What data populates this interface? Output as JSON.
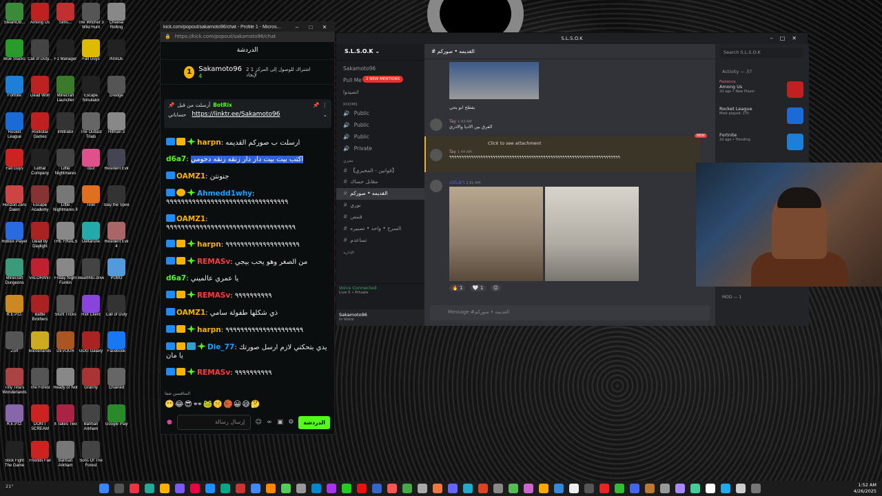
{
  "desktop": {
    "icons": [
      {
        "label": "SteamDB...",
        "color": "#3a8a3a"
      },
      {
        "label": "Among Us",
        "color": "#c02020"
      },
      {
        "label": "Sims...",
        "color": "#c03030"
      },
      {
        "label": "The Witcher 3 Wild Hunt",
        "color": "#555"
      },
      {
        "label": "Cheese Rolling",
        "color": "#888"
      },
      {
        "label": "Blue Stacks",
        "color": "#2a9a2a"
      },
      {
        "label": "Call of Duty...",
        "color": "#444"
      },
      {
        "label": "F1 Manager",
        "color": "#222"
      },
      {
        "label": "Fall Guys",
        "color": "#ddbb00"
      },
      {
        "label": "INSIDE",
        "color": "#222"
      },
      {
        "label": "Fortnite",
        "color": "#1d7fd8"
      },
      {
        "label": "Dead Wolf",
        "color": "#bb2222"
      },
      {
        "label": "Minecraft Launcher",
        "color": "#3a7a2a"
      },
      {
        "label": "Escape Simulator",
        "color": "#222"
      },
      {
        "label": "Dredge",
        "color": "#555"
      },
      {
        "label": "Rocket League",
        "color": "#1a6bd8"
      },
      {
        "label": "Rockstar Games",
        "color": "#c02020"
      },
      {
        "label": "Infiltrator",
        "color": "#333"
      },
      {
        "label": "The Outlast Trials",
        "color": "#666"
      },
      {
        "label": "Hitman 3",
        "color": "#888"
      },
      {
        "label": "Fall Guys",
        "color": "#cc2222"
      },
      {
        "label": "Lethal Company",
        "color": "#222"
      },
      {
        "label": "Little Nightmares",
        "color": "#444"
      },
      {
        "label": "osu!",
        "color": "#e0508a"
      },
      {
        "label": "Resident Evil",
        "color": "#445"
      },
      {
        "label": "Horizon Zero Dawn",
        "color": "#cc4444"
      },
      {
        "label": "Escape Academy",
        "color": "#883333"
      },
      {
        "label": "Little Nightmares II",
        "color": "#777"
      },
      {
        "label": "Tinkr",
        "color": "#e07020"
      },
      {
        "label": "Slay the Spire",
        "color": "#333"
      },
      {
        "label": "Roblox Player",
        "color": "#2a6ae0"
      },
      {
        "label": "Dead by Daylight",
        "color": "#aa2222"
      },
      {
        "label": "THE FINALS",
        "color": "#888"
      },
      {
        "label": "Deltarune",
        "color": "#2aa"
      },
      {
        "label": "Resident Evil 4",
        "color": "#a66"
      },
      {
        "label": "Minecraft Dungeons",
        "color": "#3a9a7a"
      },
      {
        "label": "VALORANT",
        "color": "#c02030"
      },
      {
        "label": "Friday Night Funkin",
        "color": "#888"
      },
      {
        "label": "BeamNG.drive",
        "color": "#444"
      },
      {
        "label": "PUBG",
        "color": "#5599dd"
      },
      {
        "label": "R.E.P.O.",
        "color": "#cc8822"
      },
      {
        "label": "Battle Brothers",
        "color": "#aa2222"
      },
      {
        "label": "Stunt Tricks",
        "color": "#555"
      },
      {
        "label": "Riot Client",
        "color": "#8844dd"
      },
      {
        "label": "Call of Duty",
        "color": "#333"
      },
      {
        "label": "Zort",
        "color": "#555"
      },
      {
        "label": "Borderlands",
        "color": "#ccaa22"
      },
      {
        "label": "DEVOUR",
        "color": "#aa5522"
      },
      {
        "label": "GOG Galaxy",
        "color": "#aa2222"
      },
      {
        "label": "Facebook",
        "color": "#1877f2"
      },
      {
        "label": "Tiny Tina's Wonderlands",
        "color": "#aa4444"
      },
      {
        "label": "The Forest",
        "color": "#555"
      },
      {
        "label": "Ready or Not",
        "color": "#888"
      },
      {
        "label": "Granny",
        "color": "#aa3333"
      },
      {
        "label": "Chained",
        "color": "#666"
      },
      {
        "label": "R.E.P.O.",
        "color": "#8866aa"
      },
      {
        "label": "DON'T SCREAM",
        "color": "#cc2222"
      },
      {
        "label": "It Takes Two",
        "color": "#aa2244"
      },
      {
        "label": "Batman Arkham",
        "color": "#444"
      },
      {
        "label": "Google Play",
        "color": "#2a8a2a"
      },
      {
        "label": "Stick Fight The Game",
        "color": "#222"
      },
      {
        "label": "Friends Fall",
        "color": "#cc2222"
      },
      {
        "label": "Batman Arkham",
        "color": "#777"
      },
      {
        "label": "Sons Of The Forest",
        "color": "#444"
      }
    ]
  },
  "kick": {
    "window_title": "kick.com/popout/sakamoto96/chat - Profile 1 - Micros...",
    "url": "https://kick.com/popout/sakamoto96/chat",
    "chat_title": "الدردشة",
    "goal": {
      "name": "Sakamoto96",
      "count": "4",
      "text": "2 اشتراك للوصول إلى المركز 1 لإيجاد",
      "rank": "1"
    },
    "pinned": {
      "label": "أرسلت من قبل",
      "bot": "BotRix",
      "prefix": "حساباتي",
      "link": "https://linktr.ee/Sakamoto96"
    },
    "messages": [
      {
        "user": "harpn",
        "color": "#f5b400",
        "badges": [
          "mod",
          "crown",
          "star"
        ],
        "text": "ارسلت ب صوركم القديمه"
      },
      {
        "user": "d6a7",
        "color": "#53fc18",
        "badges": [],
        "text": "اكتب بيت بيت دار دار زنقه زنقه دحومي",
        "highlight": true
      },
      {
        "user": "OAMZ1",
        "color": "#f5b400",
        "badges": [
          "mod"
        ],
        "text": "جنونتن"
      },
      {
        "user": "Ahmedd1why",
        "color": "#1fa2ff",
        "badges": [
          "mod",
          "sub",
          "star"
        ],
        "text": "٩٩٩٩٩٩٩٩٩٩٩٩٩٩٩٩٩٩٩٩٩٩٩٩٩٩٩٩٩٩٩٩٩"
      },
      {
        "user": "OAMZ1",
        "color": "#f5b400",
        "badges": [
          "mod"
        ],
        "text": "٩٩٩٩٩٩٩٩٩٩٩٩٩٩٩٩٩٩٩٩٩٩٩٩٩٩٩٩٩٩٩٩٩٩٩"
      },
      {
        "user": "harpn",
        "color": "#f5b400",
        "badges": [
          "mod",
          "crown",
          "star"
        ],
        "text": "٩٩٩٩٩٩٩٩٩٩٩٩٩٩٩٩٩٩٩٩"
      },
      {
        "user": "REMASv",
        "color": "#ff3b3b",
        "badges": [
          "mod",
          "crown",
          "star"
        ],
        "text": "من الصغر وهو يحب بيجي"
      },
      {
        "user": "d6a7",
        "color": "#53fc18",
        "badges": [],
        "text": "يا عمري عالميني"
      },
      {
        "user": "REMASv",
        "color": "#ff3b3b",
        "badges": [
          "mod",
          "crown",
          "star"
        ],
        "text": "٩٩٩٩٩٩٩٩٩٩"
      },
      {
        "user": "OAMZ1",
        "color": "#f5b400",
        "badges": [
          "mod"
        ],
        "text": "ذي شكلها طفولة سامي"
      },
      {
        "user": "harpn",
        "color": "#f5b400",
        "badges": [
          "mod",
          "crown",
          "star"
        ],
        "text": "٩٩٩٩٩٩٩٩٩٩٩٩٩٩٩٩٩٩٩٩٩"
      },
      {
        "user": "Die_77",
        "color": "#1fa2ff",
        "badges": [
          "mod",
          "crown",
          "gift",
          "star"
        ],
        "text": "يدي بتحكتي لازم ارسل صورتك يا مان"
      },
      {
        "user": "REMASv",
        "color": "#ff3b3b",
        "badges": [
          "mod",
          "crown",
          "star"
        ],
        "text": "٩٩٩٩٩٩٩٩٩٩"
      }
    ],
    "emote_bar_label": "المنافسين شفا",
    "emotes": "😬😂😎👓🐸🤫🏀😀😅🤔",
    "input_placeholder": "إرسال رسالة",
    "send_label": "الدردشة"
  },
  "discord": {
    "window_title": "S.L.S.O.K",
    "server_name": "S.L.S.O.K",
    "mention_badge": "2 NEW MENTIONS",
    "channels_top": [
      "Sakamoto96",
      "Pull Me",
      "اتصيدوا"
    ],
    "rooms_category": "ROOMS",
    "rooms": [
      "Public",
      "Public",
      "Public",
      "Private"
    ],
    "text_category": "مقيري",
    "channels": [
      "【قوانين - المخبري】",
      "مقابل حساك",
      "القديمه • صوركم",
      "نوري",
      "قنبص",
      "السرح • واحد • تصبيره",
      "تساعدم"
    ],
    "bottom_category": "الإداريه",
    "active_channel": "القديمه • صوركم",
    "voice_status": "Voice Connected",
    "voice_sub": "Live 5 • Private",
    "user_name": "Sakamoto96",
    "user_status": "In Voice",
    "messages": [
      {
        "author": "",
        "text": "يفطح ابو يحي"
      },
      {
        "author": "Tay",
        "time": "1:43 AM",
        "text": "الفرق بين الاديا والاذري"
      },
      {
        "author": "Tay",
        "time": "1:44 AM",
        "text": "٩٩٩٩٩٩٩٩٩٩٩٩٩٩٩٩٩٩٩٩٩٩٩٩٩٩٩٩٩٩٩٩٩٩٩٩٩٩٩٩٩٩٩٩٩٩٩٩٩٩٩٩٩٩٩٩٩٩٩٩٩٩٩٩٩٩٩٩٩٩٩"
      },
      {
        "author": "ՀՕՆՅՂ",
        "time": "1:51 AM",
        "text": ""
      }
    ],
    "attachment_hint": "Click to see attachment",
    "reactions": [
      {
        "emoji": "🔥",
        "count": "1"
      },
      {
        "emoji": "🤍",
        "count": "1"
      }
    ],
    "new_label": "NEW",
    "compose_placeholder": "Message #القديمه • صوركم",
    "search_placeholder": "Search S.L.S.O.K",
    "activity_header": "Activity — 37",
    "activities": [
      {
        "user": "Faslanca",
        "game": "Among Us",
        "sub": "2d ago • New Player",
        "color": "#c02020"
      },
      {
        "user": "",
        "game": "Rocket League",
        "sub": "Most played: 27h",
        "color": "#1a6bd8"
      },
      {
        "user": "",
        "game": "Fortnite",
        "sub": "2d ago • Trending",
        "color": "#1d7fd8"
      }
    ],
    "mod_header": "MOD — 1"
  },
  "taskbar": {
    "time": "1:52 AM",
    "date": "4/26/2025",
    "temp": "21°"
  }
}
